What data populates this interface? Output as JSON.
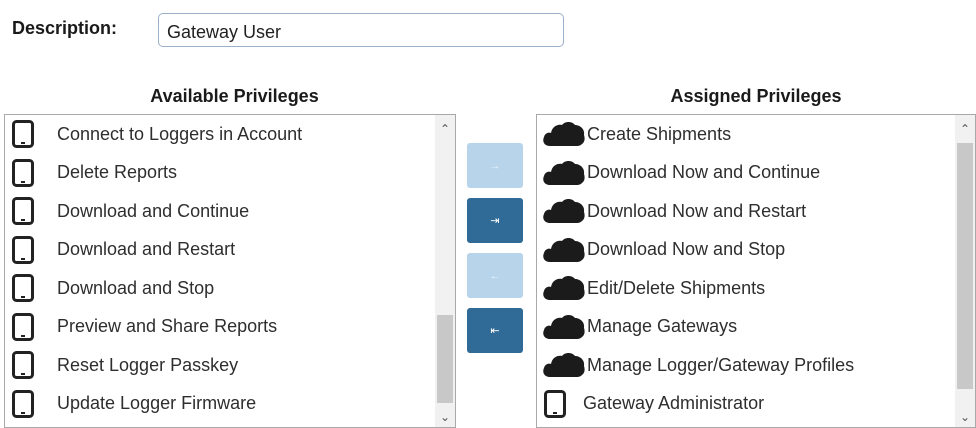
{
  "description": {
    "label": "Description:",
    "value": "Gateway User"
  },
  "available": {
    "title": "Available Privileges",
    "items": [
      {
        "label": "Connect to Loggers in Account",
        "icon": "tablet-icon"
      },
      {
        "label": "Delete Reports",
        "icon": "tablet-icon"
      },
      {
        "label": "Download and Continue",
        "icon": "tablet-icon"
      },
      {
        "label": "Download and Restart",
        "icon": "tablet-icon"
      },
      {
        "label": "Download and Stop",
        "icon": "tablet-icon"
      },
      {
        "label": "Preview and Share Reports",
        "icon": "tablet-icon"
      },
      {
        "label": "Reset Logger Passkey",
        "icon": "tablet-icon"
      },
      {
        "label": "Update Logger Firmware",
        "icon": "tablet-icon"
      }
    ]
  },
  "assigned": {
    "title": "Assigned Privileges",
    "items": [
      {
        "label": "Create Shipments",
        "icon": "cloud-icon"
      },
      {
        "label": "Download Now and Continue",
        "icon": "cloud-icon"
      },
      {
        "label": "Download Now and Restart",
        "icon": "cloud-icon"
      },
      {
        "label": "Download Now and Stop",
        "icon": "cloud-icon"
      },
      {
        "label": "Edit/Delete Shipments",
        "icon": "cloud-icon"
      },
      {
        "label": "Manage Gateways",
        "icon": "cloud-icon"
      },
      {
        "label": "Manage Logger/Gateway Profiles",
        "icon": "cloud-icon"
      },
      {
        "label": "Gateway Administrator",
        "icon": "tablet-icon"
      }
    ]
  },
  "buttons": {
    "add_selected": "→",
    "add_all": "⇥",
    "remove_selected": "←",
    "remove_all": "⇤"
  },
  "colors": {
    "button_active": "#2f6b96",
    "button_disabled": "#b8d4ea",
    "input_border": "#9ab0c8"
  }
}
